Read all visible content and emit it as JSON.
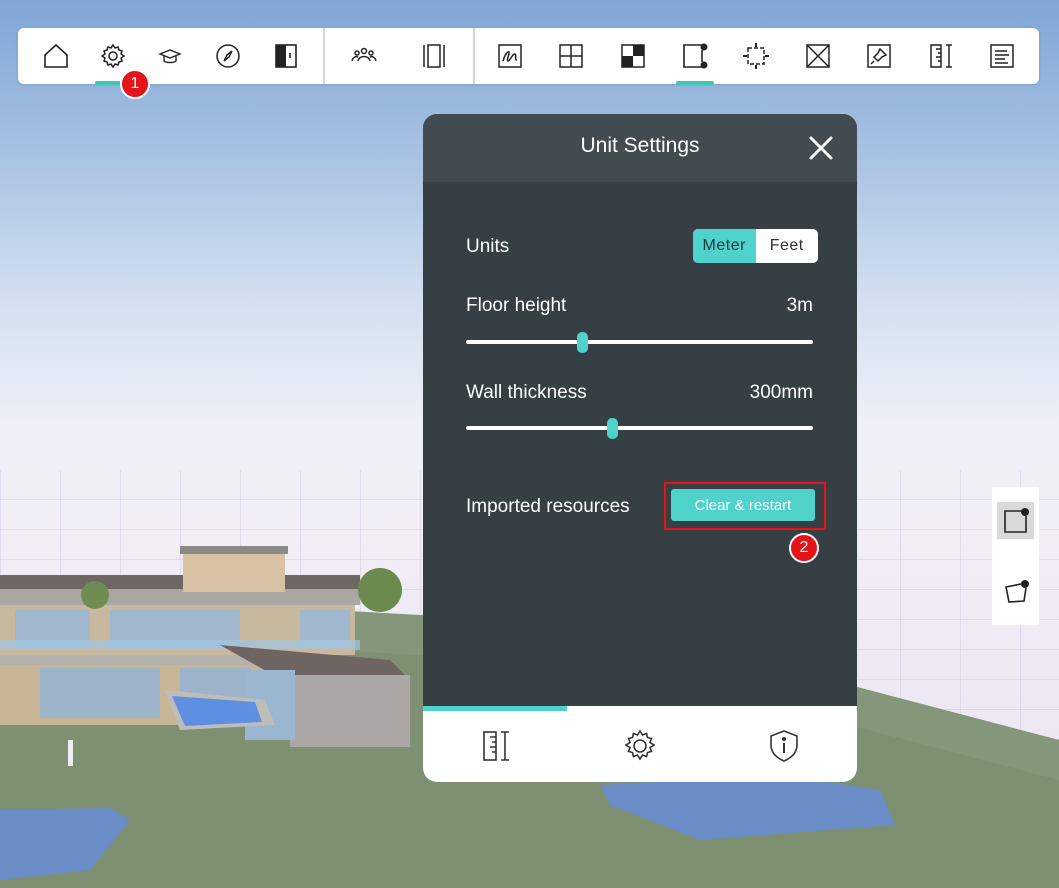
{
  "toolbar": {
    "tools": [
      "home-icon",
      "gear-icon",
      "graduation-cap-icon",
      "compass-icon",
      "door-panel-icon",
      "people-icon",
      "column-icon",
      "scribble-icon",
      "grid-cross-icon",
      "checker-icon",
      "node-square-icon",
      "select-square-icon",
      "cross-box-icon",
      "pin-box-icon",
      "ruler-icon",
      "list-icon"
    ],
    "active": [
      "gear-icon",
      "node-square-icon"
    ]
  },
  "annotations": {
    "badge_1": "1",
    "badge_2": "2"
  },
  "panel": {
    "title": "Unit Settings",
    "units": {
      "label": "Units",
      "options": [
        "Meter",
        "Feet"
      ],
      "selected": "Meter"
    },
    "floor_height": {
      "label": "Floor height",
      "value": "3m",
      "level": 0.335
    },
    "wall_thickness": {
      "label": "Wall thickness",
      "value": "300mm",
      "level": 0.42
    },
    "imported": {
      "label": "Imported resources",
      "button": "Clear & restart"
    },
    "footer_tabs": [
      "ruler-icon",
      "gear-icon",
      "shield-info-icon"
    ],
    "footer_active": "ruler-icon"
  },
  "side_tools": [
    "node-square-icon",
    "node-polygon-icon"
  ],
  "colors": {
    "accent": "#4fd1cc",
    "toolbar_active": "#3ec7b5",
    "badge": "#e4141a",
    "panel": "#353f44"
  }
}
